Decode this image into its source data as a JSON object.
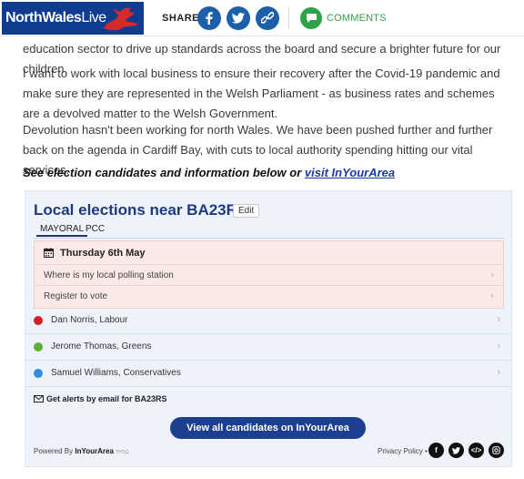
{
  "header": {
    "logo_bold": "NorthWales",
    "logo_light": "Live",
    "share_label": "SHARE",
    "comments_label": "COMMENTS",
    "icons": [
      "facebook-icon",
      "twitter-icon",
      "link-icon",
      "comments-icon"
    ]
  },
  "article": {
    "paragraphs": [
      "education sector to drive up standards across the board and secure a brighter future for our children.",
      "I want to work with local business to ensure their recovery after the Covid-19 pandemic and make sure they are represented in the Welsh Parliament - as business rates and schemes are a devolved matter to the Welsh Government.",
      "Devolution hasn't been working for north Wales. We have been pushed further and further back on the agenda in Cardiff Bay, with cuts to local authority spending hitting our vital services."
    ],
    "see_line_text": "See election candidates and information below or ",
    "see_line_link": "visit InYourArea"
  },
  "widget": {
    "title": "Local elections near BA23RS",
    "edit_label": "Edit",
    "tabs": [
      {
        "label": "MAYORAL",
        "active": true
      },
      {
        "label": "PCC",
        "active": false
      }
    ],
    "date_label": "Thursday 6th May",
    "links": [
      "Where is my local polling station",
      "Register to vote"
    ],
    "candidates": [
      {
        "name": "Dan Norris, Labour",
        "color": "#d0202a"
      },
      {
        "name": "Jerome Thomas, Greens",
        "color": "#5ab030"
      },
      {
        "name": "Samuel Williams, Conservatives",
        "color": "#2e8ee0"
      }
    ],
    "alert_label": "Get alerts by email for BA23RS",
    "view_all_label": "View all candidates on InYourArea",
    "powered_by": "Powered By",
    "powered_brand": "InYourArea",
    "privacy_label": "Privacy Policy •",
    "footer_icons": [
      "facebook-icon",
      "twitter-icon",
      "embed-icon",
      "instagram-icon"
    ]
  },
  "colors": {
    "brand_blue": "#1d3f8f",
    "comments_green": "#2fa347",
    "date_panel": "#fbe9e7",
    "widget_bg": "#eef3fb"
  }
}
